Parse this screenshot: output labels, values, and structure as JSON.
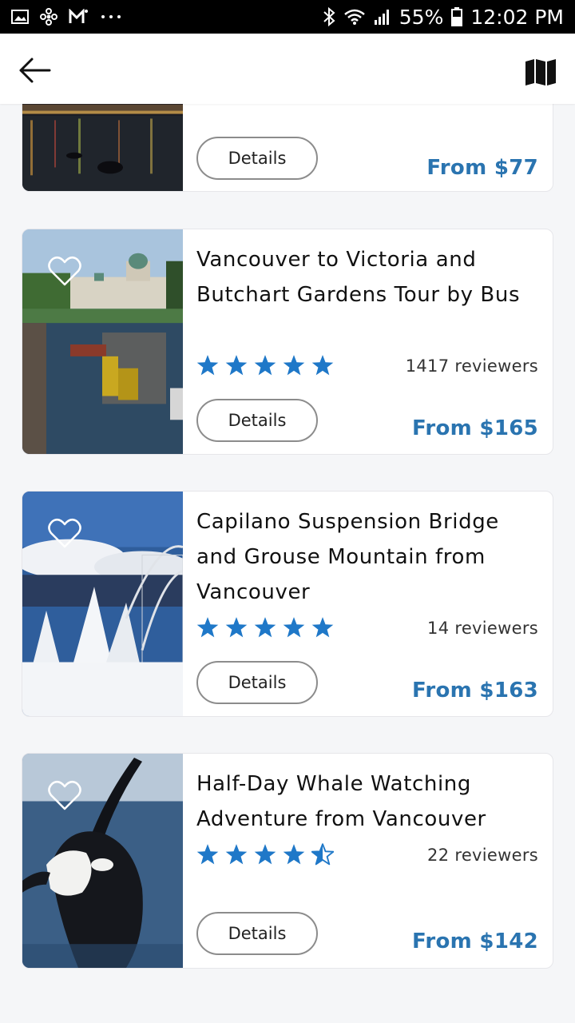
{
  "status_bar": {
    "carrier_icons": [
      "image-icon",
      "pinwheel-icon",
      "gmail-icon",
      "more-dots-icon"
    ],
    "battery": "55%",
    "time": "12:02 PM"
  },
  "app_bar": {
    "back_icon": "arrow-left-icon",
    "map_icon": "map-icon"
  },
  "tours": [
    {
      "title": "",
      "rating": null,
      "reviewers": "",
      "details_label": "Details",
      "price": "From $77",
      "image": "night-harbor-lights"
    },
    {
      "title": "Vancouver to Victoria and Butchart Gardens Tour by Bus",
      "rating": 5,
      "reviewers": "1417 reviewers",
      "details_label": "Details",
      "price": "From $165",
      "image": "victoria-harbour-parliament"
    },
    {
      "title": "Capilano Suspension Bridge and Grouse Mountain from Vancouver",
      "rating": 5,
      "reviewers": "14 reviewers",
      "details_label": "Details",
      "price": "From $163",
      "image": "snowy-trees-gondola"
    },
    {
      "title": "Half-Day Whale Watching Adventure from Vancouver",
      "rating": 4.5,
      "reviewers": "22 reviewers",
      "details_label": "Details",
      "price": "From $142",
      "image": "orca-breaching"
    }
  ],
  "colors": {
    "accent": "#2a74b0",
    "star": "#1f78c8",
    "background": "#f5f6f8"
  }
}
